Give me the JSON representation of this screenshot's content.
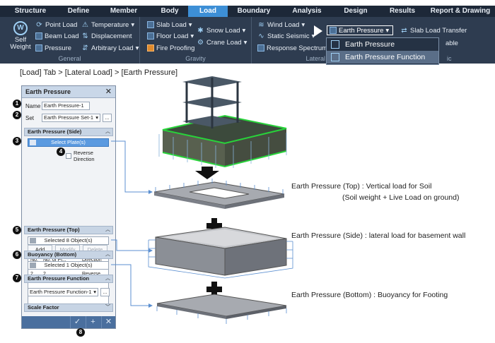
{
  "menubar": {
    "tabs": [
      "Structure",
      "Define",
      "Member",
      "Body",
      "Load",
      "Boundary",
      "Analysis",
      "Design",
      "Results",
      "Report & Drawing"
    ],
    "active": "Load"
  },
  "ribbon": {
    "groups": {
      "general": "General",
      "gravity": "Gravity",
      "lateral": "Lateral",
      "misc": "ic"
    },
    "self_weight": "Self Weight",
    "point_load": "Point Load",
    "beam_load": "Beam Load",
    "pressure": "Pressure",
    "temperature": "Temperature",
    "displacement": "Displacement",
    "arbitrary_load": "Arbitrary Load",
    "slab_load": "Slab Load",
    "floor_load": "Floor Load",
    "fire_proofing": "Fire Proofing",
    "snow_load": "Snow Load",
    "crane_load": "Crane Load",
    "wind_load": "Wind Load",
    "static_seismic": "Static Seismic",
    "response_spectrum": "Response Spectrum",
    "earth_pressure": "Earth Pressure",
    "slab_load_transfer": "Slab Load Transfer",
    "able_partial": "able",
    "dropdown": [
      "Earth Pressure",
      "Earth Pressure Function"
    ]
  },
  "breadcrumb": "[Load] Tab > [Lateral Load] > [Earth Pressure]",
  "dialog": {
    "title": "Earth Pressure",
    "name_label": "Name",
    "name_value": "Earth Pressure-1",
    "set_label": "Set",
    "set_value": "Earth Pressure Set-1",
    "more_btn": "...",
    "side_section": "Earth Pressure (Side)",
    "select_plates": "Select Plate(s)",
    "reverse_direction": "Reverse Direction",
    "add": "Add",
    "modify": "Modify",
    "delete": "Delete",
    "table_headers": [
      "No.",
      "No. of Pl...",
      "Direction"
    ],
    "table_rows": [
      [
        "1",
        "2",
        "Forward"
      ],
      [
        "2",
        "2",
        "Reverse"
      ]
    ],
    "top_section": "Earth Pressure (Top)",
    "top_selected": "Selected 8 Object(s)",
    "buoyancy_section": "Buoyancy (Bottom)",
    "buoyancy_selected": "Selected 1 Object(s)",
    "function_section": "Earth Pressure Function",
    "function_value": "Earth Pressure Function-1",
    "scale_section": "Scale Factor"
  },
  "markers": [
    "1",
    "2",
    "3",
    "4",
    "5",
    "6",
    "7",
    "8"
  ],
  "labels": {
    "top_line1": "Earth Pressure (Top) : Vertical load for Soil",
    "top_line2": "(Soil weight + Live Load on ground)",
    "side": "Earth Pressure (Side) : lateral load for basement wall",
    "bottom": "Earth Pressure (Bottom) : Buoyancy for Footing"
  },
  "colors": {
    "accent": "#3d8fd6",
    "ribbon": "#2e3c50",
    "menubar": "#1d2838",
    "slab": "#a7aab0",
    "load_arrow": "#5b8fd0"
  }
}
